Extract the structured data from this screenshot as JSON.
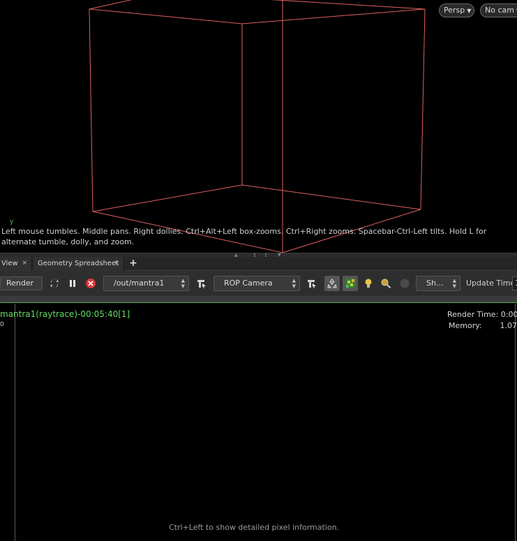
{
  "viewport": {
    "persp_label": "Persp",
    "camera_label": "No cam",
    "axis_label": "y",
    "hint": "Left mouse tumbles. Middle pans. Right dollies. Ctrl+Alt+Left box-zooms. Ctrl+Right zooms. Spacebar-Ctrl-Left tilts. Hold L for alternate tumble, dolly, and zoom.",
    "wire_color": "#e06060"
  },
  "tabs": [
    {
      "label": "View",
      "close": "×"
    },
    {
      "label": "Geometry Spreadsheet",
      "close": "×"
    }
  ],
  "tab_add": "+",
  "toolbar": {
    "render_label": "Render",
    "rop_path": "/out/mantra1",
    "rop_camera": "ROP Camera",
    "shade_label": "Sh...",
    "update_time_label": "Update Time",
    "update_time_value": "1"
  },
  "render_view": {
    "title": "mantra1(raytrace)-00:05:40[1]",
    "sub": "0",
    "render_time_label": "Render Time:",
    "render_time_value": "0:00:",
    "memory_label": "Memory:",
    "memory_value": "1.07",
    "bottom_hint": "Ctrl+Left to show detailed pixel information."
  },
  "colors": {
    "accent_green": "#66dd66",
    "stop_red": "#d93a3a",
    "background": "#000000"
  }
}
